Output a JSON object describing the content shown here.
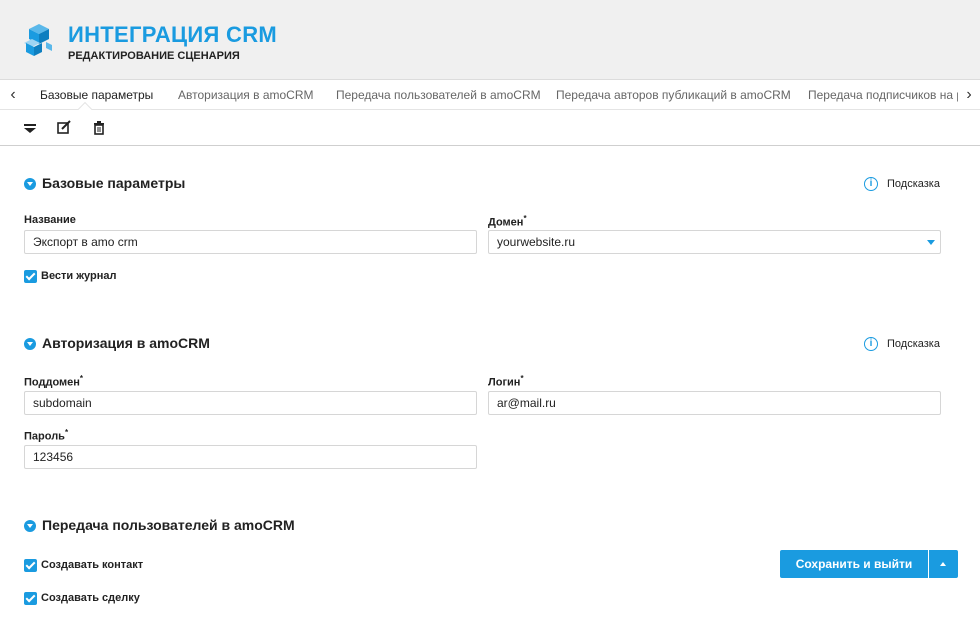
{
  "header": {
    "title": "ИНТЕГРАЦИЯ CRM",
    "subtitle": "РЕДАКТИРОВАНИЕ СЦЕНАРИЯ",
    "logo_icon": "cube-stack-logo",
    "accent_color": "#1a9be0"
  },
  "tabs": {
    "prev_icon": "chevron-left-icon",
    "next_icon": "chevron-right-icon",
    "items": [
      {
        "label": "Базовые параметры",
        "active": true
      },
      {
        "label": "Авторизация в amoCRM",
        "active": false
      },
      {
        "label": "Передача пользователей в amoCRM",
        "active": false
      },
      {
        "label": "Передача авторов публикаций в amoCRM",
        "active": false
      },
      {
        "label": "Передача подписчиков на р",
        "active": false
      }
    ]
  },
  "toolbar": {
    "icons": [
      "collapse-all-icon",
      "edit-icon",
      "trash-icon"
    ]
  },
  "hint_label": "Подсказка",
  "sections": {
    "basic": {
      "title": "Базовые параметры",
      "name_label": "Название",
      "name_value": "Экспорт в amo crm",
      "domain_label": "Домен",
      "domain_value": "yourwebsite.ru",
      "log_checkbox_label": "Вести журнал",
      "log_checked": true
    },
    "auth": {
      "title": "Авторизация в amoCRM",
      "subdomain_label": "Поддомен",
      "subdomain_value": "subdomain",
      "login_label": "Логин",
      "login_value": "ar@mail.ru",
      "password_label": "Пароль",
      "password_value": "123456"
    },
    "users": {
      "title": "Передача пользователей в amoCRM",
      "create_contact_label": "Создавать контакт",
      "create_contact_checked": true,
      "create_deal_label": "Создавать сделку",
      "create_deal_checked": true
    }
  },
  "required_mark": "*",
  "save_button": {
    "label": "Сохранить и выйти"
  }
}
